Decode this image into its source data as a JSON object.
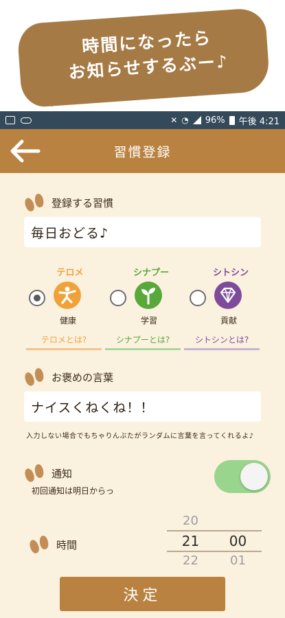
{
  "promo": {
    "line1": "時間になったら",
    "line2": "お知らせするぶー♪"
  },
  "status_bar": {
    "battery": "96%",
    "time": "午後 4:21"
  },
  "app_bar": {
    "title": "習慣登録"
  },
  "habit": {
    "label": "登録する習慣",
    "value": "毎日おどる♪"
  },
  "categories": [
    {
      "title": "テロメ",
      "sub": "健康",
      "link": "テロメとは?",
      "color": "#f0a23a",
      "selected": true,
      "icon": "exercise-person-icon"
    },
    {
      "title": "シナプー",
      "sub": "学習",
      "link": "シナプーとは?",
      "color": "#58a83a",
      "selected": false,
      "icon": "sprout-icon"
    },
    {
      "title": "シトシン",
      "sub": "貢献",
      "link": "シトシンとは?",
      "color": "#7e4b9a",
      "selected": false,
      "icon": "diamond-icon"
    }
  ],
  "praise": {
    "label": "お褒めの言葉",
    "value": "ナイスくねくね！！",
    "hint": "入力しない場合でもちゃりんぶたがランダムに言葉を言ってくれるよ♪"
  },
  "notify": {
    "label": "通知",
    "sub": "初回通知は明日からっ",
    "enabled": true
  },
  "time": {
    "label": "時間",
    "hours": [
      "20",
      "21",
      "22"
    ],
    "minutes": [
      "",
      "00",
      "01"
    ]
  },
  "submit_label": "決定"
}
